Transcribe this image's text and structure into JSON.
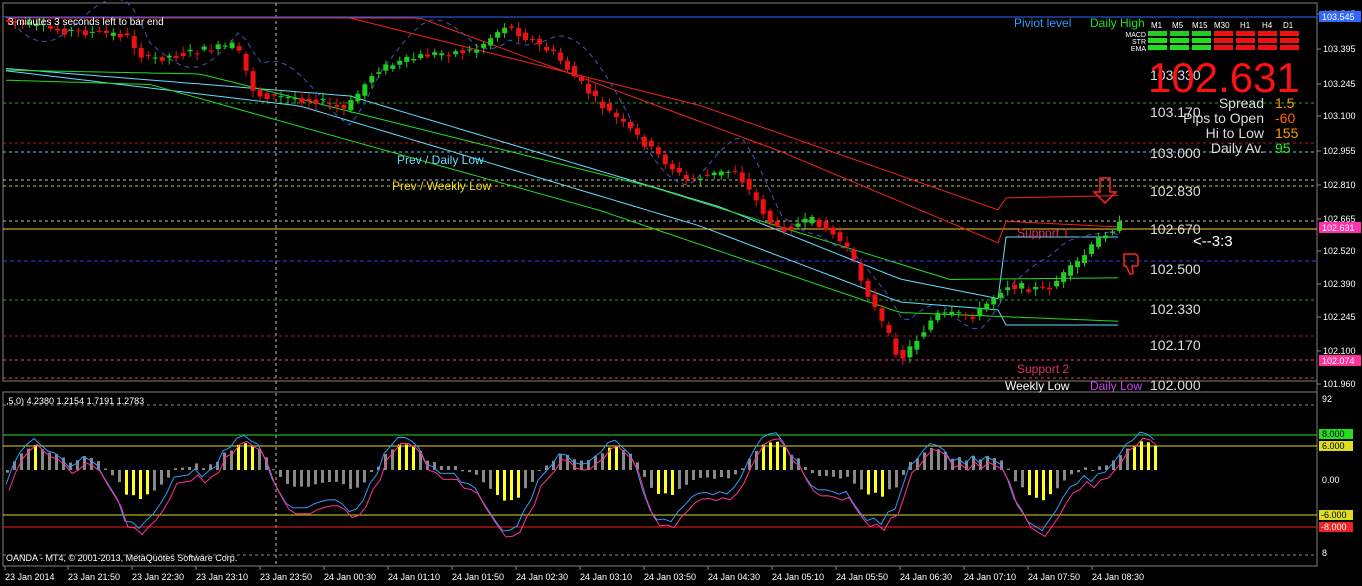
{
  "title_bar": {
    "timer_text": "3 minutes 3 seconds left to bar end",
    "copyright": "OANDA - MT4, © 2001-2013, MetaQuotes Software Corp."
  },
  "labels": {
    "pivot_level": "Piviot level",
    "daily_high": "Daily High",
    "prev_daily_low": "Prev / Daily Low",
    "prev_weekly_low": "Prev / Weekly Low",
    "support1": "Support 1",
    "support2": "Support 2",
    "weekly_low": "Weekly Low",
    "daily_low": "Daily Low",
    "arrow_note": "<--3:3"
  },
  "dashboard": {
    "timeframes": [
      "M1",
      "M5",
      "M15",
      "M30",
      "H1",
      "H4",
      "D1"
    ],
    "rows": [
      "MACD",
      "STR",
      "EMA"
    ],
    "bid_price": "102.631",
    "stats": [
      {
        "label": "Spread",
        "value": "1.5",
        "color": "#ff9900"
      },
      {
        "label": "Pips to Open",
        "value": "-60",
        "color": "#ff6600"
      },
      {
        "label": "Hi to Low",
        "value": "155",
        "color": "#ff9900"
      },
      {
        "label": "Daily Av.",
        "value": "95",
        "color": "#22ee22"
      }
    ]
  },
  "price_axis": {
    "ticks": [
      "103.545",
      "103.395",
      "103.245",
      "103.100",
      "102.955",
      "102.810",
      "102.665",
      "102.520",
      "102.390",
      "102.245",
      "102.100",
      "101.960"
    ],
    "current_label": "102.631",
    "top_label": "103.545",
    "low_label": "102.074",
    "mid_levels": [
      "103.330",
      "103.170",
      "103.000",
      "102.830",
      "102.670",
      "102.500",
      "102.330",
      "102.170",
      "102.000"
    ]
  },
  "indicator": {
    "header": ",5,0) 4.2380 1.2154 1.7191 1.2783",
    "axis_ticks": [
      "92",
      "8.000",
      "6.000",
      "0.00",
      "-6.000",
      "-8.000",
      "8"
    ],
    "level_plus8": "8.000",
    "level_plus6": "6.000",
    "level_minus6": "-6.000",
    "level_minus8": "-8.000"
  },
  "time_axis": {
    "ticks": [
      "23 Jan 2014",
      "23 Jan 21:50",
      "23 Jan 22:30",
      "23 Jan 23:10",
      "23 Jan 23:50",
      "24 Jan 00:30",
      "24 Jan 01:10",
      "24 Jan 01:50",
      "24 Jan 02:30",
      "24 Jan 03:10",
      "24 Jan 03:50",
      "24 Jan 04:30",
      "24 Jan 05:10",
      "24 Jan 05:50",
      "24 Jan 06:30",
      "24 Jan 07:10",
      "24 Jan 07:50",
      "24 Jan 08:30"
    ]
  },
  "colors": {
    "bull": "#22cc22",
    "bear": "#ee1111",
    "upper_band": "#ee2222",
    "mid_band": "#66ddff",
    "lower_band": "#22dd22"
  }
}
